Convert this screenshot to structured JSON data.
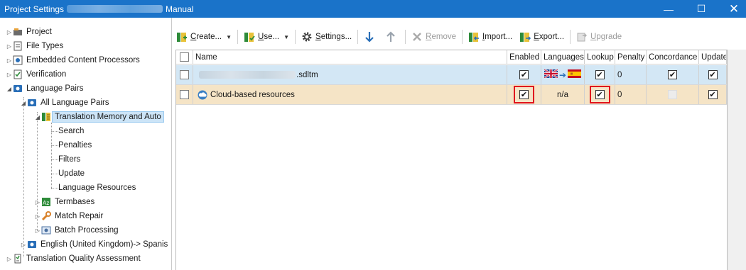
{
  "window": {
    "title_prefix": "Project Settings",
    "title_suffix": "Manual",
    "minimize_glyph": "—",
    "maximize_glyph": "☐",
    "close_glyph": "✕"
  },
  "tree": {
    "items": [
      {
        "label": "Project",
        "icon": "project-icon"
      },
      {
        "label": "File Types",
        "icon": "file-types-icon"
      },
      {
        "label": "Embedded Content Processors",
        "icon": "embedded-content-icon"
      },
      {
        "label": "Verification",
        "icon": "verification-icon"
      },
      {
        "label": "Language Pairs",
        "icon": "language-pairs-icon"
      },
      {
        "label": "All Language Pairs",
        "icon": "language-pairs-icon"
      },
      {
        "label": "Translation Memory and Auto",
        "icon": "translation-memory-icon"
      },
      {
        "label": "Search"
      },
      {
        "label": "Penalties"
      },
      {
        "label": "Filters"
      },
      {
        "label": "Update"
      },
      {
        "label": "Language Resources"
      },
      {
        "label": "Termbases",
        "icon": "termbase-icon"
      },
      {
        "label": "Match Repair",
        "icon": "wrench-icon"
      },
      {
        "label": "Batch Processing",
        "icon": "batch-processing-icon"
      },
      {
        "label": "English (United Kingdom)-> Spanis",
        "icon": "language-pairs-icon"
      },
      {
        "label": "Translation Quality Assessment",
        "icon": "tqa-icon"
      }
    ]
  },
  "toolbar": {
    "create": {
      "label": "Create...",
      "mnemonic": "C",
      "rest": "reate..."
    },
    "use": {
      "label": "Use...",
      "mnemonic": "U",
      "rest": "se..."
    },
    "settings": {
      "label": "Settings...",
      "mnemonic": "S",
      "rest": "ettings..."
    },
    "remove": {
      "label": "Remove",
      "mnemonic": "R",
      "rest": "emove"
    },
    "import": {
      "label": "Import...",
      "mnemonic": "I",
      "rest": "mport..."
    },
    "export": {
      "label": "Export...",
      "mnemonic": "E",
      "rest": "xport..."
    },
    "upgrade": {
      "label": "Upgrade",
      "mnemonic": "U",
      "rest": "pgrade"
    }
  },
  "grid": {
    "columns": [
      "Name",
      "Enabled",
      "Languages",
      "Lookup",
      "Penalty",
      "Concordance",
      "Update"
    ],
    "rows": [
      {
        "name_suffix": ".sdltm",
        "enabled": true,
        "languages": "flags",
        "lookup": true,
        "penalty": "0",
        "concordance": true,
        "update": true
      },
      {
        "name": "Cloud-based resources",
        "enabled": true,
        "languages": "n/a",
        "lookup": true,
        "penalty": "0",
        "concordance": false,
        "update": true
      }
    ]
  },
  "colors": {
    "titlebar": "#1a73c9",
    "tm_row": "#d3e7f5",
    "cloud_row": "#f5e4c6",
    "highlight": "#e0141e"
  }
}
